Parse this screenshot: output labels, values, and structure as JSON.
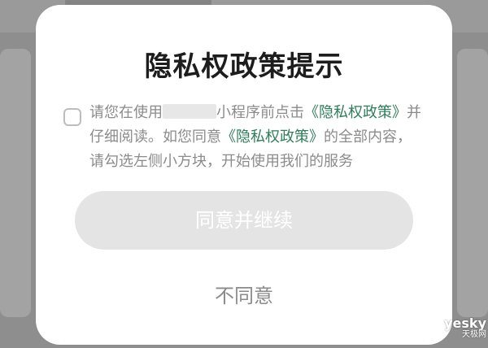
{
  "dialog": {
    "title": "隐私权政策提示",
    "consent": {
      "part1": "请您在使用",
      "part2": "小程序前点击",
      "link1": "《隐私权政策》",
      "part3": "并仔细阅读。如您同意",
      "link2": "《隐私权政策》",
      "part4": "的全部内容，请勾选左侧小方块，开始使用我们的服务"
    },
    "agree_label": "同意并继续",
    "disagree_label": "不同意"
  },
  "colors": {
    "link": "#2e7d5b",
    "agree_disabled_bg": "#e4e4e4",
    "secondary_text": "#8b8b8b"
  },
  "watermark": {
    "brand": "yesky",
    "sub": "天极网"
  }
}
